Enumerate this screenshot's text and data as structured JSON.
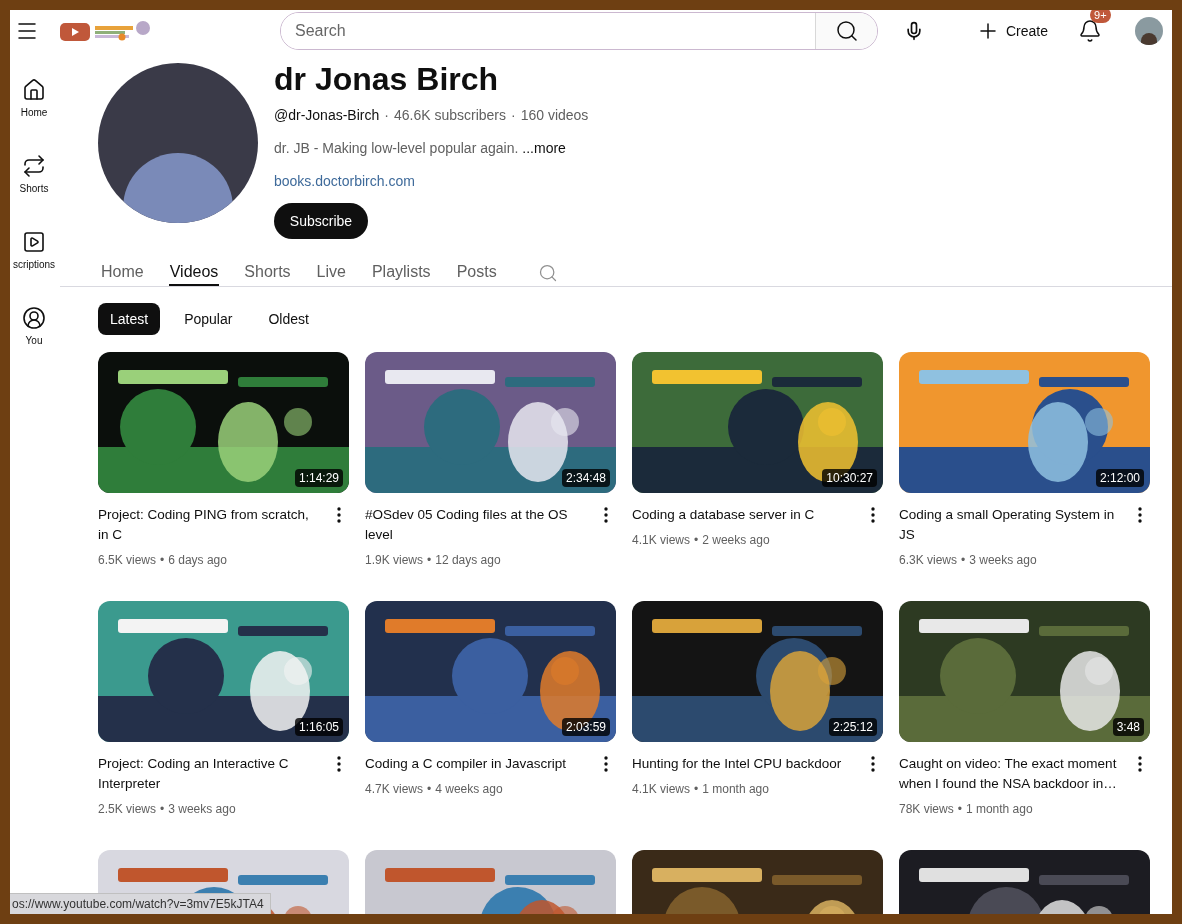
{
  "header": {
    "search": {
      "placeholder": "Search"
    },
    "create": "Create",
    "notifications": "9+"
  },
  "sidebar": {
    "items": [
      {
        "kind": "home",
        "label": "Home"
      },
      {
        "kind": "shorts",
        "label": "Shorts"
      },
      {
        "kind": "subscriptions",
        "label": "scriptions"
      },
      {
        "kind": "you",
        "label": "You"
      }
    ]
  },
  "channel": {
    "name": "dr Jonas Birch",
    "handle": "@dr-Jonas-Birch",
    "separator_1": "·",
    "subscribers": "46.6K subscribers",
    "separator_2": "·",
    "videos": "160 videos",
    "description": "dr. JB - Making low-level popular again.",
    "more": "...more",
    "link": "books.doctorbirch.com",
    "subscribe": "Subscribe"
  },
  "tabs": [
    {
      "label": "Home",
      "selected": false
    },
    {
      "label": "Videos",
      "selected": true
    },
    {
      "label": "Shorts",
      "selected": false
    },
    {
      "label": "Live",
      "selected": false
    },
    {
      "label": "Playlists",
      "selected": false
    },
    {
      "label": "Posts",
      "selected": false
    }
  ],
  "chips": [
    {
      "label": "Latest",
      "selected": true
    },
    {
      "label": "Popular",
      "selected": false
    },
    {
      "label": "Oldest",
      "selected": false
    }
  ],
  "videos": [
    {
      "thumbnail": {
        "kind": "picture"
      },
      "duration": "1:14:29",
      "title": "Project: Coding PING from scratch, in C",
      "views": "6.5K views",
      "separator": "•",
      "age": "6 days ago"
    },
    {
      "thumbnail": {
        "kind": "picture"
      },
      "duration": "2:34:48",
      "title": "#OSdev 05 Coding files at the OS level",
      "views": "1.9K views",
      "separator": "•",
      "age": "12 days ago"
    },
    {
      "thumbnail": {
        "kind": "picture"
      },
      "duration": "10:30:27",
      "title": "Coding a database server in C",
      "views": "4.1K views",
      "separator": "•",
      "age": "2 weeks ago"
    },
    {
      "thumbnail": {
        "kind": "picture"
      },
      "duration": "2:12:00",
      "title": "Coding a small Operating System in JS",
      "views": "6.3K views",
      "separator": "•",
      "age": "3 weeks ago"
    },
    {
      "thumbnail": {
        "kind": "picture"
      },
      "duration": "1:16:05",
      "title": "Project: Coding an Interactive C Interpreter",
      "views": "2.5K views",
      "separator": "•",
      "age": "3 weeks ago"
    },
    {
      "thumbnail": {
        "kind": "picture"
      },
      "duration": "2:03:59",
      "title": "Coding a C compiler in Javascript",
      "views": "4.7K views",
      "separator": "•",
      "age": "4 weeks ago"
    },
    {
      "thumbnail": {
        "kind": "picture"
      },
      "duration": "2:25:12",
      "title": "Hunting for the Intel CPU backdoor",
      "views": "4.1K views",
      "separator": "•",
      "age": "1 month ago"
    },
    {
      "thumbnail": {
        "kind": "picture"
      },
      "duration": "3:48",
      "title": "Caught on video: The exact moment when I found the NSA backdoor in…",
      "views": "78K views",
      "separator": "•",
      "age": "1 month ago"
    },
    {
      "thumbnail": {
        "kind": "picture"
      }
    },
    {
      "thumbnail": {
        "kind": "picture"
      }
    },
    {
      "thumbnail": {
        "kind": "picture"
      }
    },
    {
      "thumbnail": {
        "kind": "picture"
      }
    }
  ],
  "status_bar": {
    "url": "os://www.youtube.com/watch?v=3mv7E5kJTA4"
  }
}
